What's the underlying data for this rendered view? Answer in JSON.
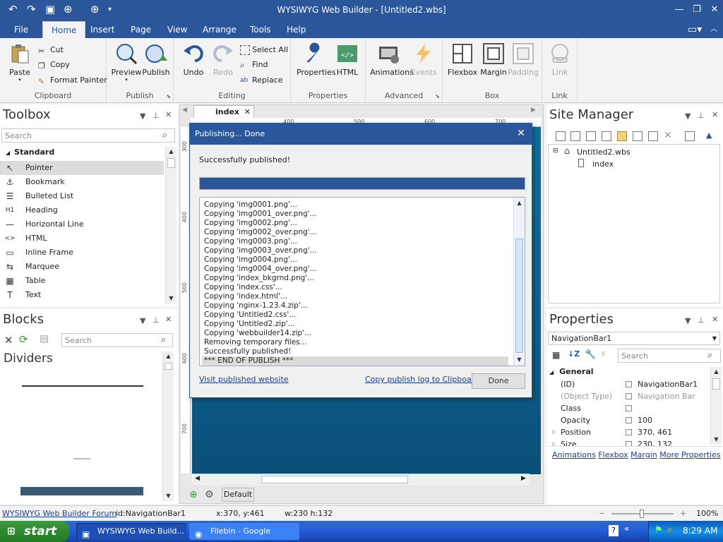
{
  "window": {
    "title": "WYSIWYG Web Builder - [Untitled2.wbs]"
  },
  "ribbon_tabs": [
    "File",
    "Home",
    "Insert",
    "Page",
    "View",
    "Arrange",
    "Tools",
    "Help"
  ],
  "ribbon": {
    "clipboard": {
      "label": "Clipboard",
      "paste": "Paste",
      "cut": "Cut",
      "copy": "Copy",
      "format_painter": "Format Painter"
    },
    "publish": {
      "label": "Publish",
      "preview": "Preview",
      "publish": "Publish"
    },
    "editing": {
      "label": "Editing",
      "undo": "Undo",
      "redo": "Redo",
      "select_all": "Select All",
      "find": "Find",
      "replace": "Replace"
    },
    "properties": {
      "label": "Properties",
      "properties": "Properties",
      "html": "HTML"
    },
    "advanced": {
      "label": "Advanced",
      "animations": "Animations",
      "events": "Events"
    },
    "box": {
      "label": "Box",
      "flexbox": "Flexbox",
      "margin": "Margin",
      "padding": "Padding"
    },
    "link": {
      "label": "Link",
      "link": "Link"
    }
  },
  "toolbox": {
    "title": "Toolbox",
    "search_placeholder": "Search",
    "category": "Standard",
    "items": [
      {
        "label": "Pointer",
        "icon": "pointer-icon",
        "glyph": "↖"
      },
      {
        "label": "Bookmark",
        "icon": "anchor-icon",
        "glyph": "⚓"
      },
      {
        "label": "Bulleted List",
        "icon": "bulleted-list-icon",
        "glyph": "☰"
      },
      {
        "label": "Heading",
        "icon": "heading-icon",
        "glyph": "H1"
      },
      {
        "label": "Horizontal Line",
        "icon": "horizontal-line-icon",
        "glyph": "—"
      },
      {
        "label": "HTML",
        "icon": "html-code-icon",
        "glyph": "<>"
      },
      {
        "label": "Inline Frame",
        "icon": "inline-frame-icon",
        "glyph": "▭"
      },
      {
        "label": "Marquee",
        "icon": "marquee-icon",
        "glyph": "⇆"
      },
      {
        "label": "Table",
        "icon": "table-icon",
        "glyph": "▦"
      },
      {
        "label": "Text",
        "icon": "text-icon",
        "glyph": "T"
      }
    ]
  },
  "blocks": {
    "title": "Blocks",
    "search_placeholder": "Search",
    "category": "Dividers"
  },
  "editor": {
    "tab": "index",
    "ruler_h": [
      "300",
      "400",
      "500",
      "600",
      "700"
    ],
    "ruler_v": [
      "300",
      "400",
      "500",
      "600",
      "700"
    ],
    "footer_label": "Default"
  },
  "dialog": {
    "title": "Publishing... Done",
    "message": "Successfully published!",
    "progress": 1.0,
    "log": [
      "Copying 'img0001.png'...",
      "Copying 'img0001_over.png'...",
      "Copying 'img0002.png'...",
      "Copying 'img0002_over.png'...",
      "Copying 'img0003.png'...",
      "Copying 'img0003_over.png'...",
      "Copying 'img0004.png'...",
      "Copying 'img0004_over.png'...",
      "Copying 'index_bkgrnd.png'...",
      "Copying 'index.css'...",
      "Copying 'index.html'...",
      "Copying 'nginx-1.23.4.zip'...",
      "Copying 'Untitled2.css'...",
      "Copying 'Untitled2.zip'...",
      "Copying 'webbuilder14.zip'...",
      "Removing temporary files...",
      "Successfully published!",
      "*** END OF PUBLISH ***"
    ],
    "visit_link": "Visit published website",
    "copy_link": "Copy publish log to Clipboard",
    "done_button": "Done"
  },
  "site_manager": {
    "title": "Site Manager",
    "root": "Untitled2.wbs",
    "page": "index"
  },
  "properties": {
    "title": "Properties",
    "object": "NavigationBar1",
    "search_placeholder": "Search",
    "section": "General",
    "rows": [
      {
        "name": "(ID)",
        "value": "NavigationBar1",
        "dim": false
      },
      {
        "name": "(Object Type)",
        "value": "Navigation Bar",
        "dim": true
      },
      {
        "name": "Class",
        "value": "",
        "dim": false
      },
      {
        "name": "Opacity",
        "value": "100",
        "dim": false
      },
      {
        "name": "Position",
        "value": "370, 461",
        "dim": false
      },
      {
        "name": "Size",
        "value": "230, 132",
        "dim": false
      }
    ],
    "links": [
      "Animations",
      "Flexbox",
      "Margin",
      "More Properties"
    ]
  },
  "statusbar": {
    "forum_link": "WYSIWYG Web Builder Forum",
    "id": "id:NavigationBar1",
    "pos": "x:370, y:461",
    "size": "w:230 h:132",
    "zoom": "100%"
  },
  "taskbar": {
    "start": "start",
    "items": [
      "WYSIWYG Web Build...",
      "Filebin - Google Chrome"
    ],
    "clock": "8:29 AM"
  },
  "colors": {
    "accent": "#2b579a",
    "canvas": "#0f6e9a",
    "taskbar": "#245edb",
    "start": "#2f8a2f"
  }
}
